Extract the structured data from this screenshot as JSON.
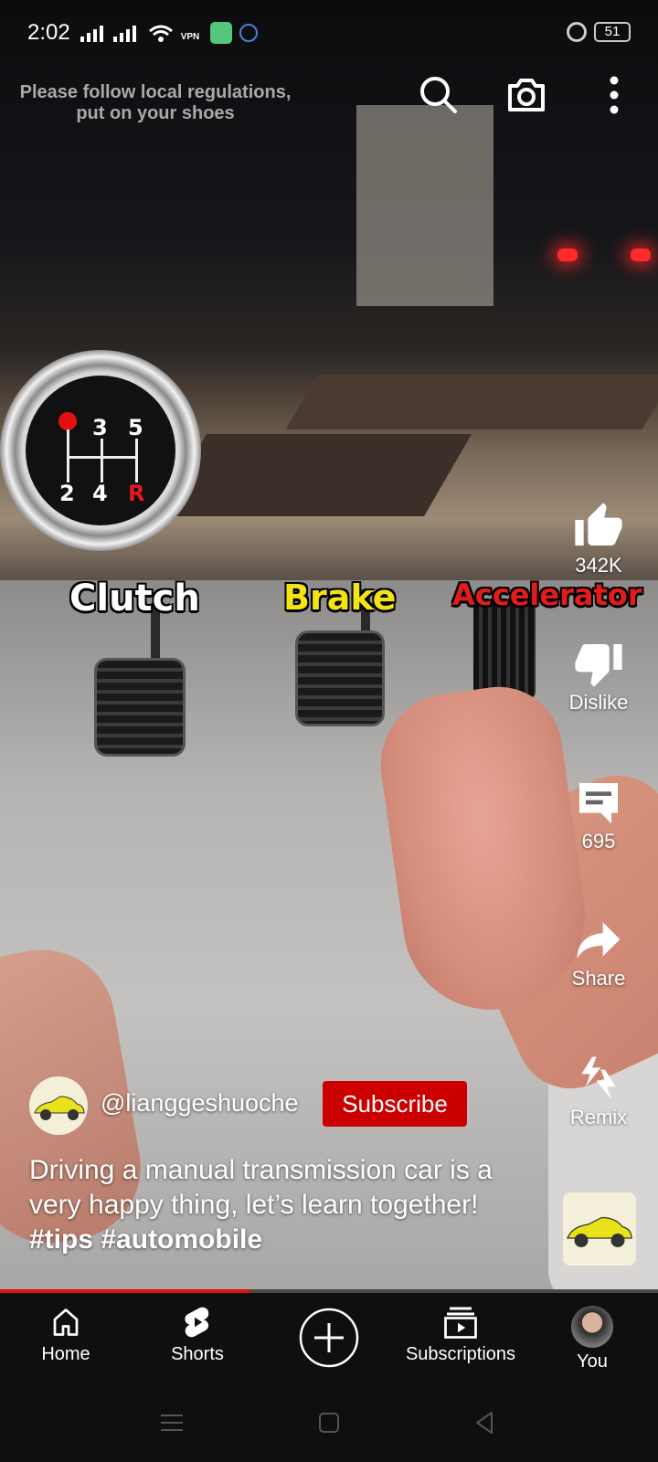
{
  "status_bar": {
    "time": "2:02",
    "vpn_label": "VPN",
    "battery": "51"
  },
  "video": {
    "notice": "Please follow local regulations, put on your shoes",
    "labels": {
      "clutch": "Clutch",
      "brake": "Brake",
      "accelerator": "Accelerator"
    },
    "gear_numbers": {
      "top_mid": "3",
      "top_right": "5",
      "bottom_left": "2",
      "bottom_mid": "4",
      "reverse": "R"
    }
  },
  "top_bar": {
    "icons": [
      "search-icon",
      "camera-icon",
      "more-vert-icon"
    ]
  },
  "actions": {
    "like_count": "342K",
    "dislike_label": "Dislike",
    "comment_count": "695",
    "share_label": "Share",
    "remix_label": "Remix"
  },
  "video_info": {
    "channel": "@lianggeshuoche",
    "subscribe_label": "Subscribe",
    "description": "Driving a manual transmission car is a very happy thing, let’s learn together!",
    "hashtags": "#tips #automobile"
  },
  "progress": 0.38,
  "bottom_nav": {
    "home": "Home",
    "shorts": "Shorts",
    "subscriptions": "Subscriptions",
    "you": "You"
  },
  "colors": {
    "subscribe_red": "#cc0000",
    "progress_red": "#e01010",
    "brake_label": "#f3e312",
    "accelerator_label": "#e31b1b"
  }
}
